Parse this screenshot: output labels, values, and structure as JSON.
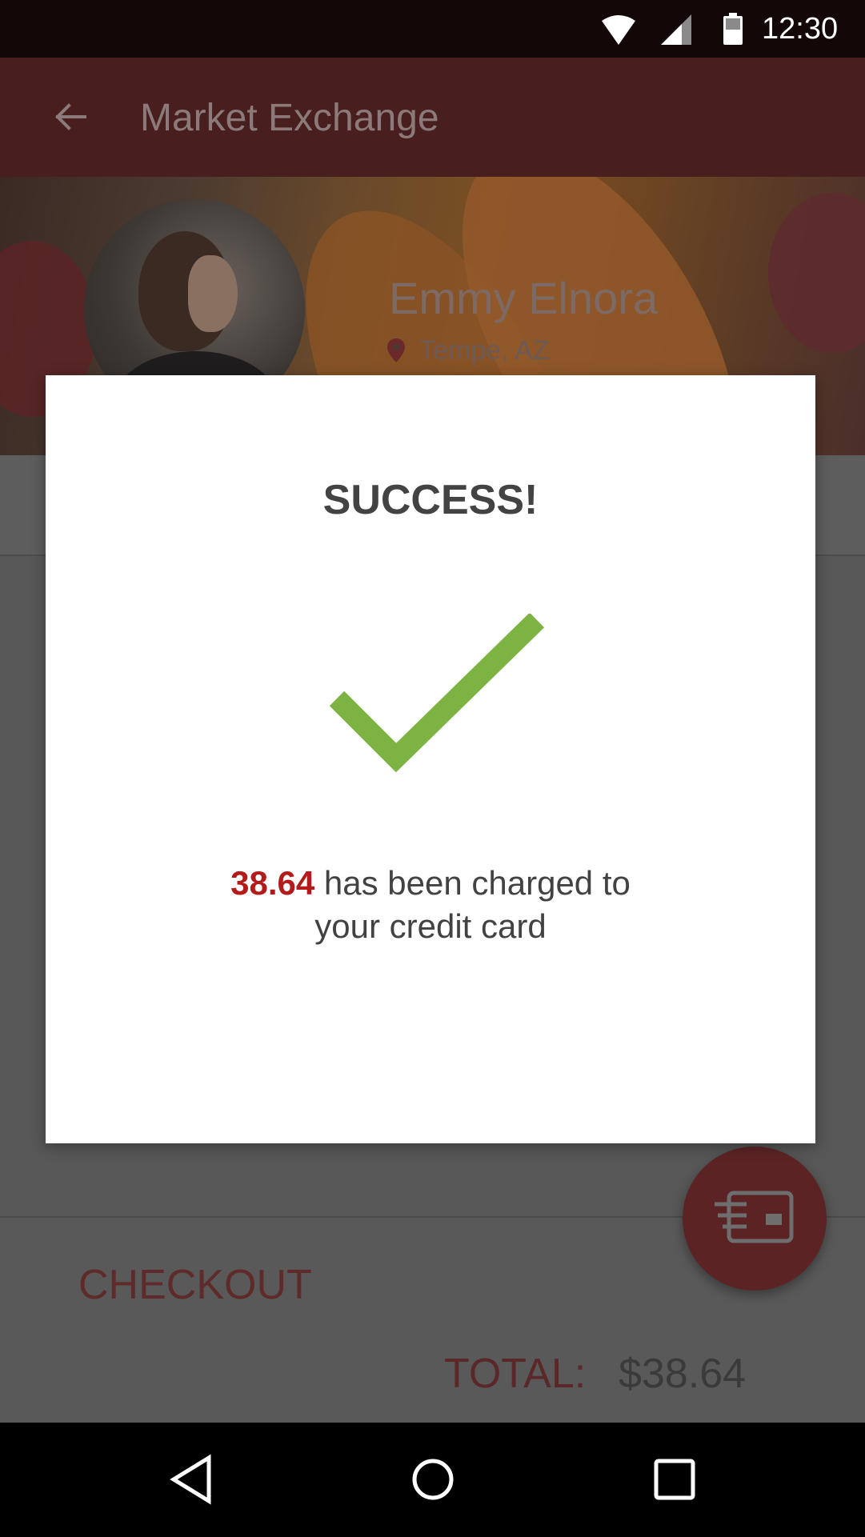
{
  "status_bar": {
    "time": "12:30",
    "icons": [
      "wifi-icon",
      "cell-signal-icon",
      "battery-icon"
    ]
  },
  "app_bar": {
    "title": "Market Exchange",
    "back_icon": "arrow-back-icon"
  },
  "seller": {
    "name": "Emmy Elnora",
    "location": "Tempe, AZ",
    "location_icon": "map-pin-icon"
  },
  "dialog": {
    "title": "SUCCESS!",
    "icon": "checkmark-icon",
    "amount": "38.64",
    "message_line1_rest": " has been charged to",
    "message_line2": "your credit card"
  },
  "checkout": {
    "title": "CHECKOUT",
    "total_label": "TOTAL:",
    "total_value": "$38.64",
    "fab_icon": "credit-card-icon"
  },
  "nav_bar": {
    "icons": [
      "nav-back-icon",
      "nav-home-icon",
      "nav-recents-icon"
    ]
  },
  "colors": {
    "app_bar": "#491e1f",
    "accent_red": "#b31b1b",
    "success_green": "#7cb342",
    "scrim": "#5a5a5a"
  }
}
